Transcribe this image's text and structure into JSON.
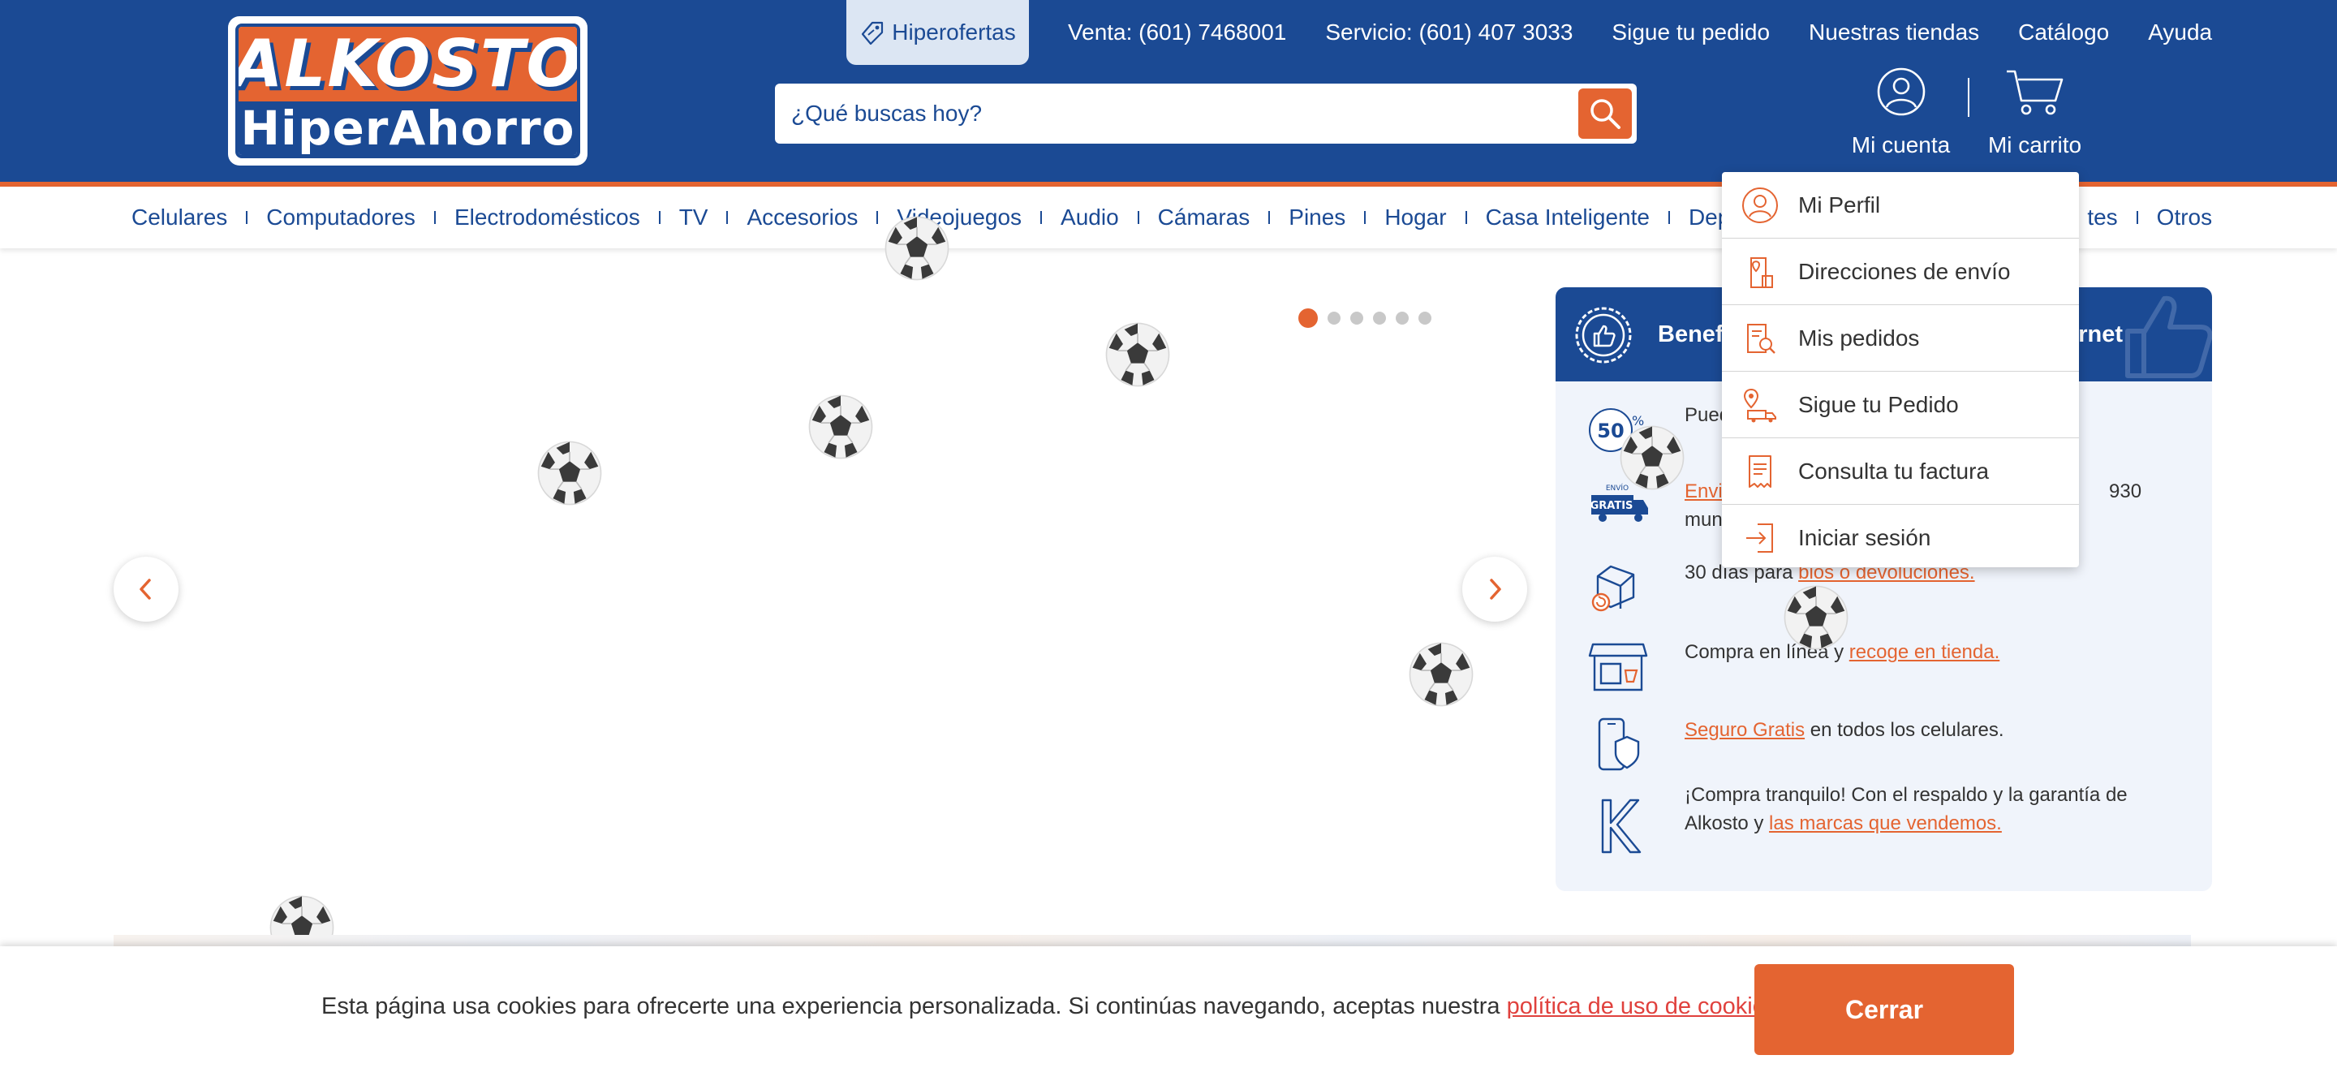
{
  "brand": {
    "logo_top": "ALKOSTO",
    "logo_bottom": "HiperAhorro"
  },
  "colors": {
    "primary": "#1b4a94",
    "accent": "#e46431",
    "panel_bg": "#f0f4fb"
  },
  "topnav": {
    "hiperofertas": "Hiperofertas",
    "links": [
      "Venta: (601) 7468001",
      "Servicio: (601) 407 3033",
      "Sigue tu pedido",
      "Nuestras tiendas",
      "Catálogo",
      "Ayuda"
    ]
  },
  "search": {
    "placeholder": "¿Qué buscas hoy?",
    "icon": "search-icon"
  },
  "header_actions": {
    "account": "Mi cuenta",
    "cart": "Mi carrito"
  },
  "categories": [
    "Celulares",
    "Computadores",
    "Electrodomésticos",
    "TV",
    "Accesorios",
    "Videojuegos",
    "Audio",
    "Cámaras",
    "Pines",
    "Hogar",
    "Casa Inteligente",
    "Dep",
    "tes",
    "Otros"
  ],
  "carousel": {
    "slide_count": 6,
    "active_slide": 1
  },
  "benefits": {
    "title_start": "Benef",
    "title_end": "rnet",
    "items": [
      {
        "icon": "discount-50-icon",
        "text": "Pued"
      },
      {
        "icon": "free-shipping-icon",
        "link": "Envi",
        "text_end": "930",
        "line2": "mun"
      },
      {
        "icon": "returns-box-icon",
        "text": "30 días para ",
        "link": "bios o devoluciones."
      },
      {
        "icon": "store-icon",
        "text": "Compra en línea y ",
        "link": "recoge en tienda."
      },
      {
        "icon": "phone-shield-icon",
        "link": "Seguro Gratis",
        "text": " en todos los celulares."
      },
      {
        "icon": "k-brand-icon",
        "text": "¡Compra tranquilo! Con el respaldo y la garantía de Alkosto y ",
        "link": "las marcas que vendemos."
      }
    ]
  },
  "account_menu": {
    "items": [
      {
        "label": "Mi Perfil",
        "icon": "profile-icon"
      },
      {
        "label": "Direcciones de envío",
        "icon": "address-icon"
      },
      {
        "label": "Mis pedidos",
        "icon": "orders-icon"
      },
      {
        "label": "Sigue tu Pedido",
        "icon": "track-order-icon"
      },
      {
        "label": "Consulta tu factura",
        "icon": "invoice-icon"
      },
      {
        "label": "Iniciar sesión",
        "icon": "login-icon"
      }
    ]
  },
  "cookie_banner": {
    "text": "Esta página usa cookies para ofrecerte una experiencia personalizada. Si continúas navegando, aceptas nuestra ",
    "link": "política de uso de cookies",
    "end": ".",
    "button": "Cerrar"
  }
}
